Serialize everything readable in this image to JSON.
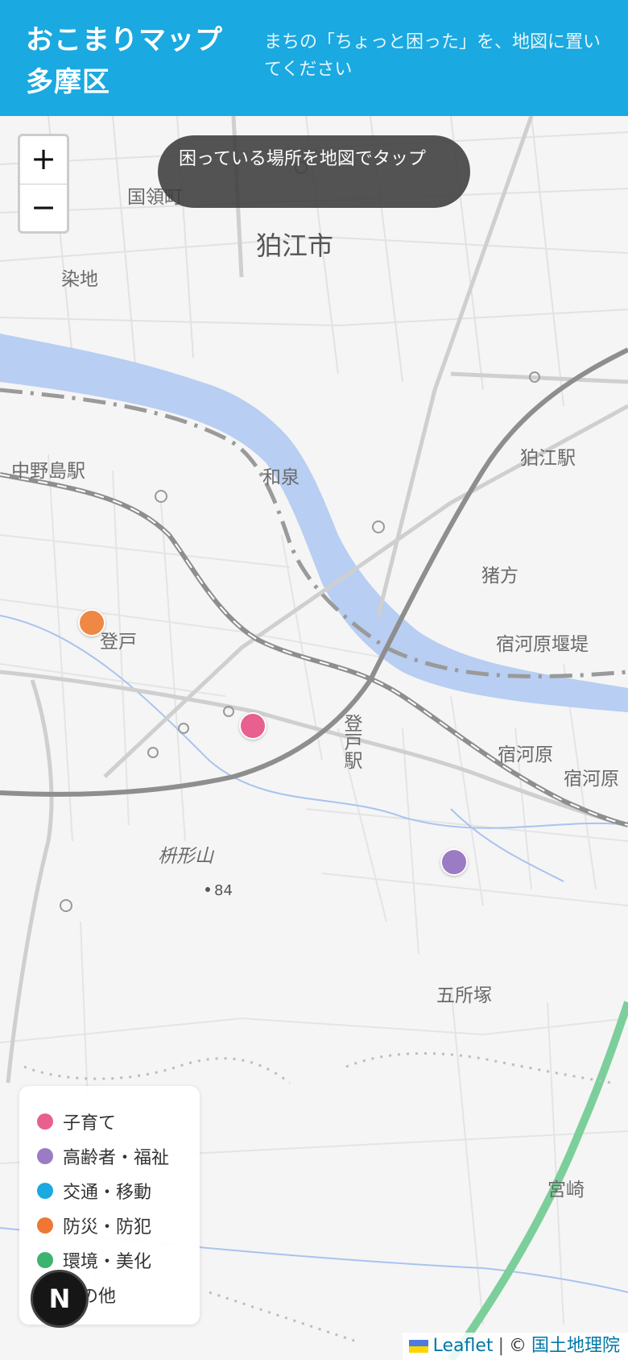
{
  "header": {
    "title_line1": "おこまりマップ",
    "title_line2": "多摩区",
    "subtitle": "まちの「ちょっと困った」を、地図に置いてください",
    "background": "#1aa9e0"
  },
  "map": {
    "zoom_in_label": "+",
    "zoom_out_label": "−",
    "hint": "困っている場所を地図でタップ",
    "place_labels": {
      "kuryocho": "国領町",
      "komae_shi": "狛江市",
      "somechi": "染地",
      "izumi": "和泉",
      "komae_eki": "狛江駅",
      "nakanoshima_eki": "中野島駅",
      "inokata": "猪方",
      "noborito": "登戸",
      "shukugawara_seki": "宿河原堰堤",
      "noborito_eki": "登戸駅",
      "shukugawara": "宿河原",
      "shukugawara2": "宿河原",
      "masugatayama": "枡形山",
      "elevation": "84",
      "goshozuka": "五所塚",
      "miyazaki": "宮崎"
    },
    "pins": [
      {
        "category": "防災・防犯",
        "color": "#ee8844"
      },
      {
        "category": "子育て",
        "color": "#e8608f"
      },
      {
        "category": "高齢者・福祉",
        "color": "#9b7bc4"
      }
    ]
  },
  "legend": {
    "items": [
      {
        "label": "子育て",
        "color": "#e8608f"
      },
      {
        "label": "高齢者・福祉",
        "color": "#9b7bc4"
      },
      {
        "label": "交通・移動",
        "color": "#1aa9e0"
      },
      {
        "label": "防災・防犯",
        "color": "#ee7733"
      },
      {
        "label": "環境・美化",
        "color": "#3cb371"
      },
      {
        "label": "その他",
        "color": "#333333"
      }
    ]
  },
  "badge": {
    "letter": "N"
  },
  "attribution": {
    "leaflet": "Leaflet",
    "separator": "|",
    "copyright": "©",
    "provider": "国土地理院"
  }
}
